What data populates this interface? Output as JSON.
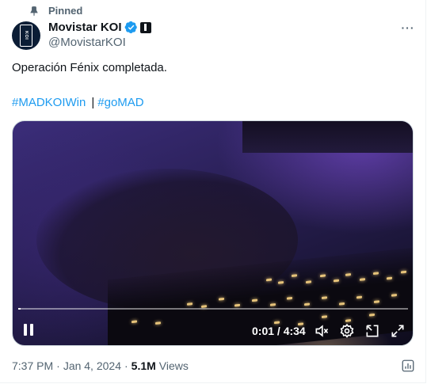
{
  "pinned_label": "Pinned",
  "author": {
    "name": "Movistar KOI",
    "handle": "@MovistarKOI",
    "avatar_text": "KOI"
  },
  "tweet": {
    "text": "Operación Fénix completada.",
    "hashtags": [
      "#MADKOIWin",
      "|",
      "#goMAD"
    ]
  },
  "video": {
    "time_display": "0:01 / 4:34",
    "progress_fraction": 0.004
  },
  "meta": {
    "time": "7:37 PM",
    "date": "Jan 4, 2024",
    "separator": "·",
    "views_count": "5.1M",
    "views_label": "Views"
  },
  "colors": {
    "accent": "#1d9bf0",
    "text_primary": "#0f1419",
    "text_secondary": "#536471"
  },
  "icons": {
    "pin": "pin-icon",
    "verified": "verified-badge-icon",
    "affiliate": "affiliate-badge-icon",
    "more": "more-options-icon",
    "pause": "pause-icon",
    "mute": "mute-icon",
    "settings": "settings-icon",
    "popout": "popout-icon",
    "fullscreen": "fullscreen-icon",
    "analytics": "analytics-icon"
  }
}
